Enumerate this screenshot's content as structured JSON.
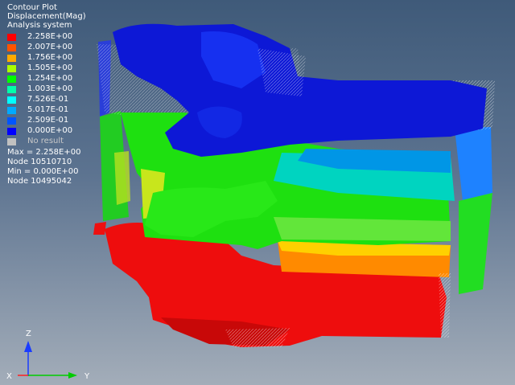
{
  "legend": {
    "title": "Contour Plot",
    "subtitle": "Displacement(Mag)",
    "system": "Analysis system",
    "entries": [
      {
        "label": "2.258E+00",
        "color": "#ff0000"
      },
      {
        "label": "2.007E+00",
        "color": "#ff5400"
      },
      {
        "label": "1.756E+00",
        "color": "#ffaa00"
      },
      {
        "label": "1.505E+00",
        "color": "#aaff00"
      },
      {
        "label": "1.254E+00",
        "color": "#00ff00"
      },
      {
        "label": "1.003E+00",
        "color": "#00ffaa"
      },
      {
        "label": "7.526E-01",
        "color": "#00ffff"
      },
      {
        "label": "5.017E-01",
        "color": "#00aaff"
      },
      {
        "label": "2.509E-01",
        "color": "#0055ff"
      },
      {
        "label": "0.000E+00",
        "color": "#0000ff"
      },
      {
        "label": "No result",
        "color": "#c0c0c0"
      }
    ]
  },
  "stats": {
    "max": "Max = 2.258E+00",
    "max_node": "Node 10510710",
    "min": "Min = 0.000E+00",
    "min_node": "Node 10495042"
  },
  "triad": {
    "z_label": "Z",
    "y_label": "Y",
    "x_label": "X",
    "z_color": "#1a3cff",
    "y_color": "#00cc00",
    "x_color": "#ff2020"
  }
}
